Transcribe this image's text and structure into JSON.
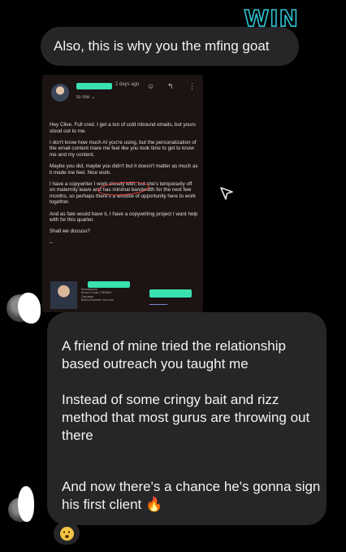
{
  "overlay": {
    "label": "WIN"
  },
  "messages": {
    "first": "Also, this is why you the mfing goat",
    "second": {
      "p1": "A friend of mine tried the relationship based outreach you taught me",
      "p2": "Instead of some cringy bait and rizz method that most gurus are throwing out there",
      "p3": "And now there's a chance he's gonna sign his first client",
      "emoji": "🔥"
    }
  },
  "email": {
    "time": "2 days ago",
    "to": "to me",
    "paragraphs": [
      "Hey Clive. Full cred. I get a ton of cold inbound emails, but yours stood out to me.",
      "I don't know how much AI you're using, but the personalization of the email content mare me feel like you took time to get to know me and my content.",
      "Maybe you did, maybe you didn't but it doesn't matter as much as it made me feel. Nice work.",
      "I have a copywriter I work closely with, but she's temporarily off on maternity leave and has minimal bandwidth for the next few months, so perhaps there's a window of opportunity here to work together.",
      "And as fate would have it, I have a copywriting project I want help with for this quarter.",
      "Shall we discuss?",
      "--"
    ],
    "signature": {
      "line1": "Development",
      "line2": "Boston Center | RE/MAX",
      "line3": "Canvasse",
      "line4": "Build a Business You Love"
    }
  },
  "reaction": {
    "icon": "surprised-face-emoji"
  },
  "colors": {
    "accent": "#2ec4d6",
    "bubble": "#262628",
    "highlight": "#39e0b0",
    "circle": "#e0403a"
  }
}
